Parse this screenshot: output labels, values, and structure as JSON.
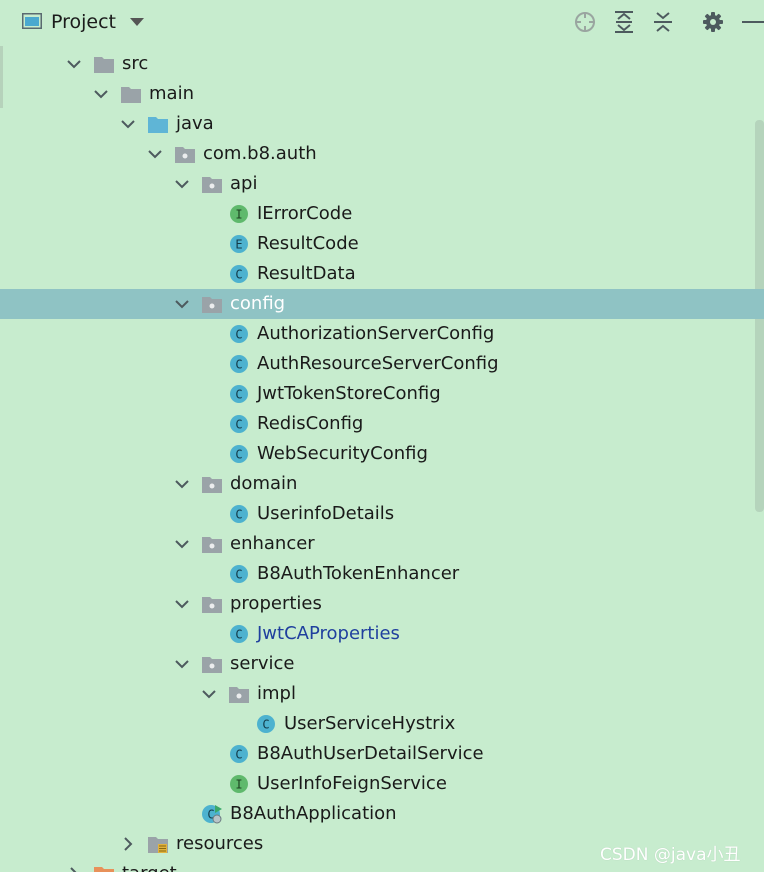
{
  "header": {
    "title": "Project",
    "icons": [
      "project-view-icon",
      "dropdown-caret-icon",
      "locate-icon",
      "expand-all-icon",
      "collapse-all-icon",
      "gear-icon",
      "hide-icon"
    ]
  },
  "colors": {
    "background": "#c7ecce",
    "selection": "#8fc3c4",
    "folder": "#9aa3a8",
    "source_folder": "#5fb5d6",
    "class_icon": "#4db2cf",
    "interface_icon": "#5fb96c",
    "link_text": "#1f3f9e"
  },
  "tree": [
    {
      "label": "src",
      "icon": "folder-icon",
      "expanded": true
    },
    {
      "label": "main",
      "icon": "folder-icon",
      "expanded": true
    },
    {
      "label": "java",
      "icon": "source-folder-icon",
      "expanded": true
    },
    {
      "label": "com.b8.auth",
      "icon": "package-icon",
      "expanded": true
    },
    {
      "label": "api",
      "icon": "package-icon",
      "expanded": true
    },
    {
      "label": "IErrorCode",
      "icon": "interface-icon",
      "badge": "I"
    },
    {
      "label": "ResultCode",
      "icon": "enum-icon",
      "badge": "E"
    },
    {
      "label": "ResultData",
      "icon": "class-icon",
      "badge": "C"
    },
    {
      "label": "config",
      "icon": "package-icon",
      "expanded": true,
      "selected": true
    },
    {
      "label": "AuthorizationServerConfig",
      "icon": "class-icon",
      "badge": "C"
    },
    {
      "label": "AuthResourceServerConfig",
      "icon": "class-icon",
      "badge": "C"
    },
    {
      "label": "JwtTokenStoreConfig",
      "icon": "class-icon",
      "badge": "C"
    },
    {
      "label": "RedisConfig",
      "icon": "class-icon",
      "badge": "C"
    },
    {
      "label": "WebSecurityConfig",
      "icon": "class-icon",
      "badge": "C"
    },
    {
      "label": "domain",
      "icon": "package-icon",
      "expanded": true
    },
    {
      "label": "UserinfoDetails",
      "icon": "class-icon",
      "badge": "C"
    },
    {
      "label": "enhancer",
      "icon": "package-icon",
      "expanded": true
    },
    {
      "label": "B8AuthTokenEnhancer",
      "icon": "class-icon",
      "badge": "C"
    },
    {
      "label": "properties",
      "icon": "package-icon",
      "expanded": true
    },
    {
      "label": "JwtCAProperties",
      "icon": "class-icon",
      "badge": "C",
      "modified": true
    },
    {
      "label": "service",
      "icon": "package-icon",
      "expanded": true
    },
    {
      "label": "impl",
      "icon": "package-icon",
      "expanded": true
    },
    {
      "label": "UserServiceHystrix",
      "icon": "class-icon",
      "badge": "C"
    },
    {
      "label": "B8AuthUserDetailService",
      "icon": "class-icon",
      "badge": "C"
    },
    {
      "label": "UserInfoFeignService",
      "icon": "interface-icon",
      "badge": "I"
    },
    {
      "label": "B8AuthApplication",
      "icon": "spring-boot-app-icon",
      "badge": "C"
    },
    {
      "label": "resources",
      "icon": "resources-folder-icon",
      "expanded": false
    },
    {
      "label": "target",
      "icon": "excluded-folder-icon",
      "expanded": false
    }
  ],
  "watermark": "CSDN @java小丑"
}
